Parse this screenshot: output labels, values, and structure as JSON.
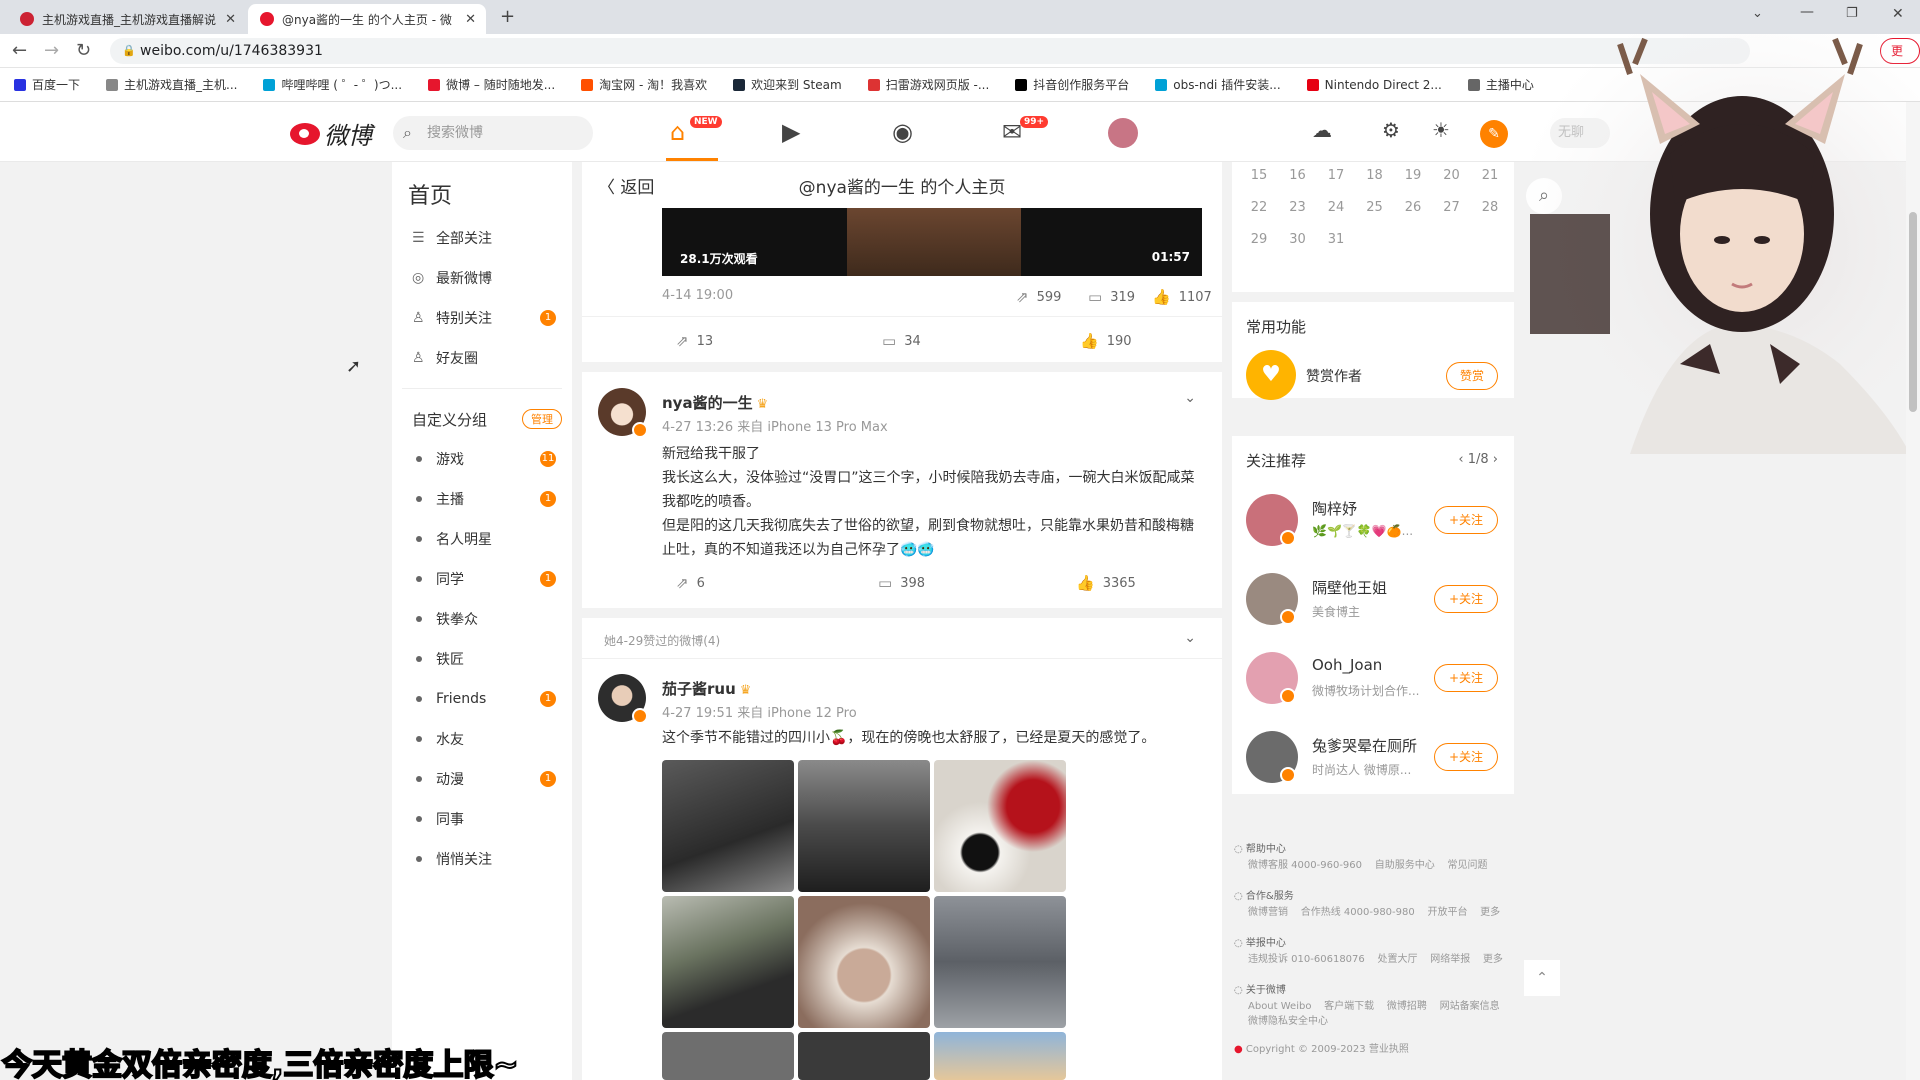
{
  "tabs": [
    {
      "label": "主机游戏直播_主机游戏直播解说"
    },
    {
      "label": "@nya酱的一生 的个人主页 - 微"
    }
  ],
  "address": "weibo.com/u/1746383931",
  "update_label": "更新",
  "bookmarks": [
    "百度一下",
    "主机游戏直播_主机...",
    "哔哩哔哩 ( ゜- ゜)つ...",
    "微博 – 随时随地发...",
    "淘宝网 - 淘！我喜欢",
    "欢迎来到 Steam",
    "扫雷游戏网页版 -...",
    "抖音创作服务平台",
    "obs-ndi 插件安装...",
    "Nintendo Direct 2...",
    "主播中心"
  ],
  "header": {
    "logo": "微博",
    "logo_sub": "weibo.com",
    "search_placeholder": "搜索微博",
    "home_badge": "NEW",
    "msg_badge": "99+",
    "cut_text": "无聊"
  },
  "leftnav": {
    "title": "首页",
    "items": [
      {
        "label": "全部关注",
        "count": ""
      },
      {
        "label": "最新微博",
        "count": ""
      },
      {
        "label": "特别关注",
        "count": "1"
      },
      {
        "label": "好友圈",
        "count": ""
      }
    ],
    "group_title": "自定义分组",
    "manage": "管理",
    "groups": [
      {
        "label": "游戏",
        "count": "11"
      },
      {
        "label": "主播",
        "count": "1"
      },
      {
        "label": "名人明星",
        "count": ""
      },
      {
        "label": "同学",
        "count": "1"
      },
      {
        "label": "铁拳众",
        "count": ""
      },
      {
        "label": "铁匠",
        "count": ""
      },
      {
        "label": "Friends",
        "count": "1"
      },
      {
        "label": "水友",
        "count": ""
      },
      {
        "label": "动漫",
        "count": "1"
      },
      {
        "label": "同事",
        "count": ""
      },
      {
        "label": "悄悄关注",
        "count": ""
      }
    ]
  },
  "center": {
    "back": "返回",
    "title": "@nya酱的一生 的个人主页",
    "video": {
      "views": "28.1万次观看",
      "duration": "01:57"
    },
    "post0": {
      "time": "4-14 19:00",
      "inner": {
        "repost": "599",
        "comment": "319",
        "like": "1107"
      },
      "repost": "13",
      "comment": "34",
      "like": "190"
    },
    "post1": {
      "name": "nya酱的一生",
      "meta": "4-27 13:26 来自 iPhone 13 Pro Max",
      "text": [
        "新冠给我干服了",
        "我长这么大，没体验过“没胃口”这三个字，小时候陪我奶去寺庙，一碗大白米饭配咸菜我都吃的喷香。",
        "但是阳的这几天我彻底失去了世俗的欲望，刷到食物就想吐，只能靠水果奶昔和酸梅糖止吐，真的不知道我还以为自己怀孕了🥶🥶"
      ],
      "repost": "6",
      "comment": "398",
      "like": "3365"
    },
    "liked_header": "她4-29赞过的微博(4)",
    "post2": {
      "name": "茄子酱ruu",
      "meta": "4-27 19:51 来自 iPhone 12 Pro",
      "text": "这个季节不能错过的四川小🍒，现在的傍晚也太舒服了，已经是夏天的感觉了。"
    }
  },
  "right": {
    "calendar": [
      [
        "15",
        "16",
        "17",
        "18",
        "19",
        "20",
        "21"
      ],
      [
        "22",
        "23",
        "24",
        "25",
        "26",
        "27",
        "28"
      ],
      [
        "29",
        "30",
        "31"
      ]
    ],
    "common_title": "常用功能",
    "reward_label": "赞赏作者",
    "reward_btn": "赞赏",
    "rec_title": "关注推荐",
    "rec_page": "1/8",
    "follow_btn": "+关注",
    "recs": [
      {
        "name": "陶梓妤",
        "sub": "🌿🌱🍸🍀💗🍊...",
        "color": "#c9707a"
      },
      {
        "name": "隔壁他王姐",
        "sub": "美食博主",
        "color": "#9a8a80"
      },
      {
        "name": "Ooh_Joan",
        "sub": "微博牧场计划合作...",
        "color": "#e3a0b0"
      },
      {
        "name": "兔爹哭晕在厕所",
        "sub": "时尚达人 微博原...",
        "color": "#6b6b6b"
      }
    ],
    "footer": [
      {
        "h": "帮助中心",
        "l": "微博客服 4000-960-960    自助服务中心    常见问题"
      },
      {
        "h": "合作&服务",
        "l": "微博营销    合作热线 4000-980-980    开放平台    更多"
      },
      {
        "h": "举报中心",
        "l": "违规投诉 010-60618076    处置大厅    网络举报    更多"
      },
      {
        "h": "关于微博",
        "l": "About Weibo    客户端下载    微博招聘    网站备案信息"
      }
    ],
    "footer_extra": "微博隐私安全中心",
    "copyright": "Copyright © 2009-2023 营业执照"
  },
  "subtitle": "今天黄金双倍亲密度,三倍亲密度上限~"
}
